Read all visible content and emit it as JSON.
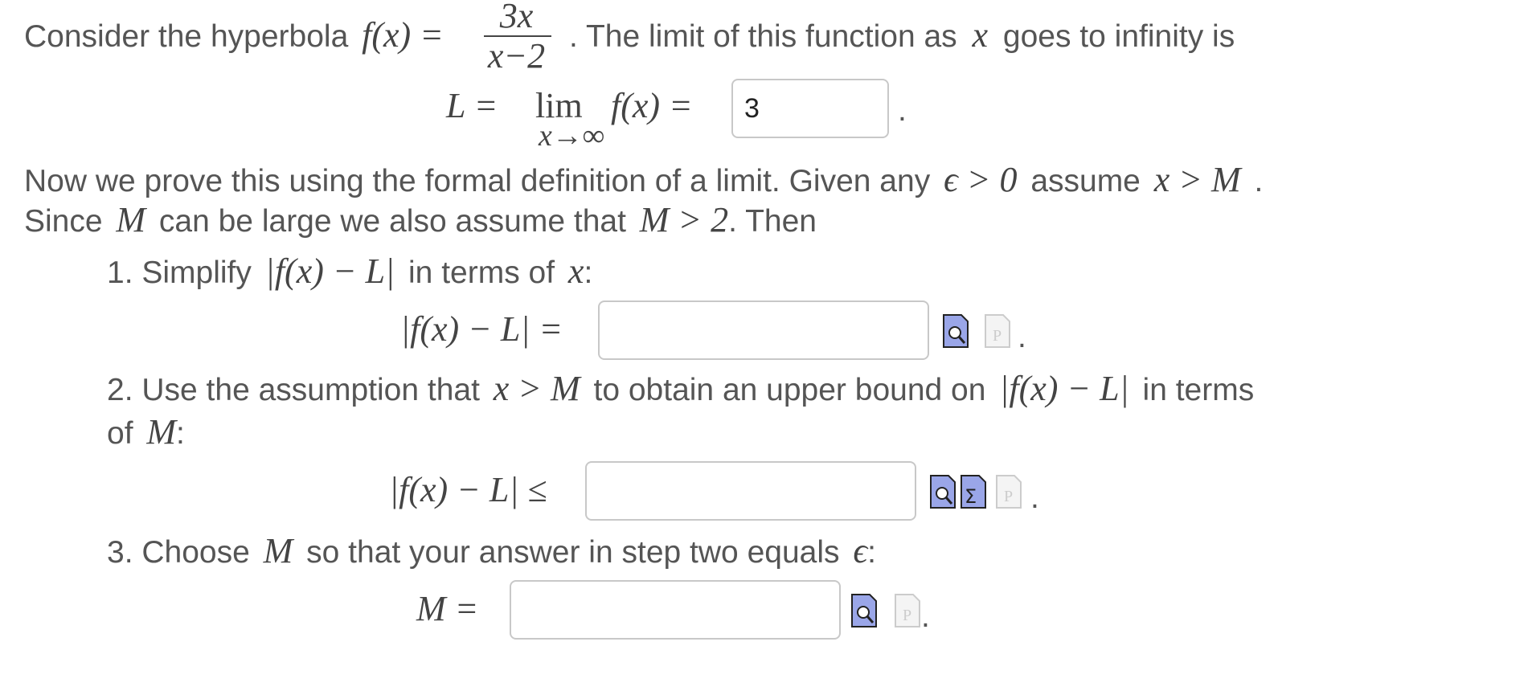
{
  "intro": {
    "text_before": "Consider the hyperbola",
    "function": "f(x) =",
    "numerator": "3x",
    "denominator": "x−2",
    "text_after": ". The limit of this function as",
    "var_x": "x",
    "text_end": "goes to infinity is"
  },
  "limit": {
    "L_eq": "L =",
    "lim": "lim",
    "sub": "x→∞",
    "fx_eq": "f(x) =",
    "value": "3",
    "period": "."
  },
  "para": {
    "line1_a": "Now we prove this using the formal definition of a limit. Given any",
    "line1_eps": "ϵ > 0",
    "line1_b": "assume",
    "line1_xm": "x > M",
    "line1_c": ".",
    "line2_a": "Since",
    "line2_M": "M",
    "line2_b": "can be large we also assume that",
    "line2_cond": "M > 2",
    "line2_c": ". Then"
  },
  "step1": {
    "label_a": "1. Simplify",
    "abs": "|f(x) − L|",
    "label_b": "in terms of",
    "x": "x",
    "colon": ":",
    "lhs": "|f(x) − L| =",
    "value": "",
    "period": "."
  },
  "step2": {
    "label_a": "2. Use the assumption that",
    "cond": "x > M",
    "label_b": "to obtain an upper bound on",
    "abs": "|f(x) − L|",
    "label_c": "in terms",
    "label_d": "of",
    "M": "M",
    "colon": ":",
    "lhs": "|f(x) − L| ≤",
    "value": "",
    "period": "."
  },
  "step3": {
    "label_a": "3. Choose",
    "M": "M",
    "label_b": "so that your answer in step two equals",
    "eps": "ϵ",
    "colon": ":",
    "lhs": "M =",
    "value": "",
    "period": "."
  },
  "icons": {
    "preview": "preview-icon",
    "equation_editor": "sigma-icon",
    "parser_help": "parser-help-icon"
  },
  "colors": {
    "text": "#555555",
    "math": "#444444",
    "box_border": "#c8c8c8",
    "icon_active": "#9aa6e8",
    "icon_disabled": "#dcdcdc"
  }
}
